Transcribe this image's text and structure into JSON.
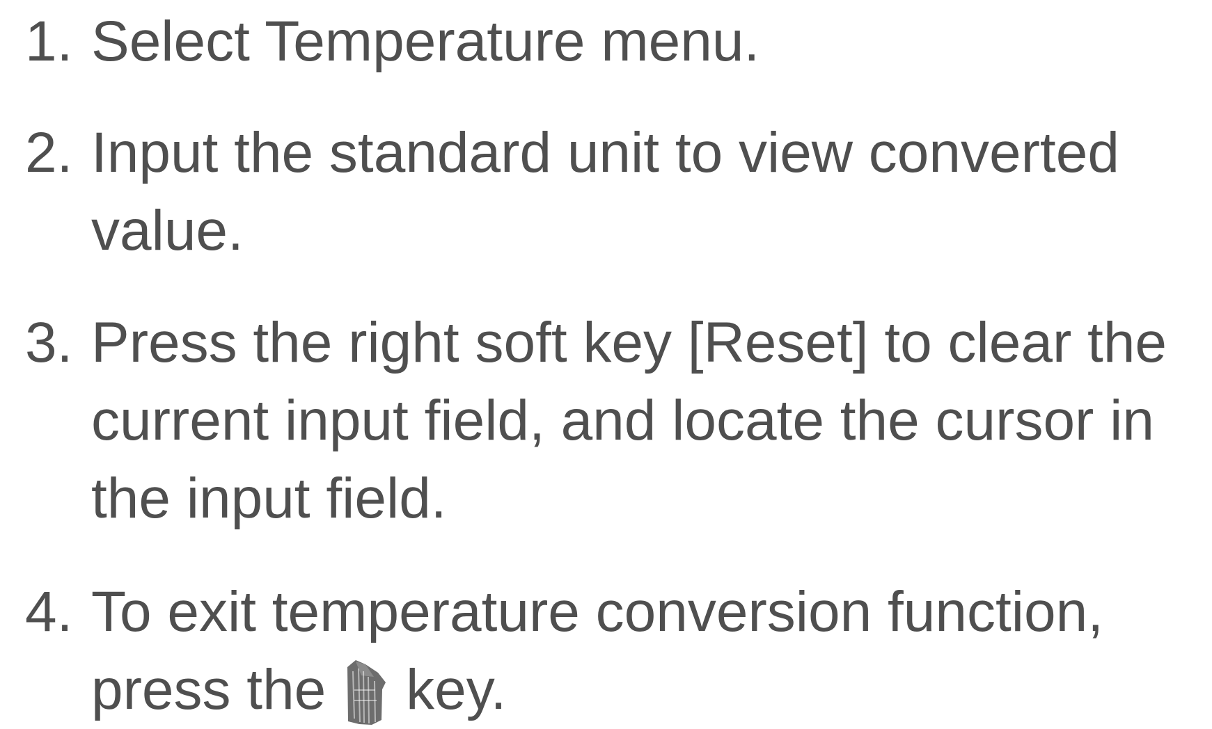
{
  "instructions": {
    "steps": [
      {
        "number": "1.",
        "lines": [
          "Select Temperature menu."
        ]
      },
      {
        "number": "2.",
        "lines": [
          "Input the standard unit to view converted",
          "value."
        ]
      },
      {
        "number": "3.",
        "lines": [
          "Press the right soft key [Reset] to clear the",
          "current input field, and locate the cursor in",
          "the input field."
        ]
      },
      {
        "number": "4.",
        "lines": [
          "To exit temperature conversion function,"
        ],
        "last_line_before": "press  the",
        "key_icon": "end-key-icon",
        "last_line_after": "key."
      }
    ]
  },
  "colors": {
    "text": "#4f4f4f",
    "key_icon": "#6d6d6d",
    "background": "#ffffff"
  }
}
